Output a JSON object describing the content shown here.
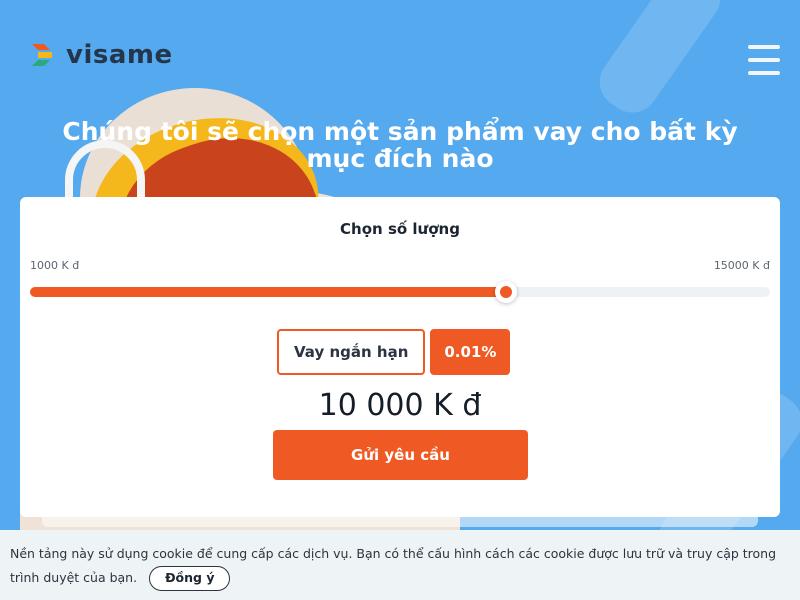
{
  "brand": {
    "name": "visame",
    "logo_colors": [
      "#ef5a24",
      "#f4b81c",
      "#2aa97e",
      "#24364c"
    ]
  },
  "header": {
    "menu_icon": "hamburger-menu-icon"
  },
  "hero": {
    "title": "Chúng tôi sẽ chọn một sản phẩm vay cho bất kỳ mục đích nào"
  },
  "calculator": {
    "title": "Chọn số lượng",
    "min_label": "1000 K đ",
    "max_label": "15000 K đ",
    "min_value": 1000,
    "max_value": 15000,
    "value": 10000,
    "term_label": "Vay ngắn hạn",
    "rate_label": "0.01%",
    "amount_display": "10 000 K đ",
    "submit_label": "Gửi yêu cầu"
  },
  "cookie": {
    "text": "Nền tảng này sử dụng cookie để cung cấp các dịch vụ. Bạn có thể cấu hình cách các cookie được lưu trữ và truy cập trong trình duyệt của bạn.",
    "accept_label": "Đồng ý"
  },
  "colors": {
    "background": "#55a9ee",
    "accent": "#ef5a24",
    "card": "#ffffff",
    "cookie_bar": "#eef3f5"
  }
}
